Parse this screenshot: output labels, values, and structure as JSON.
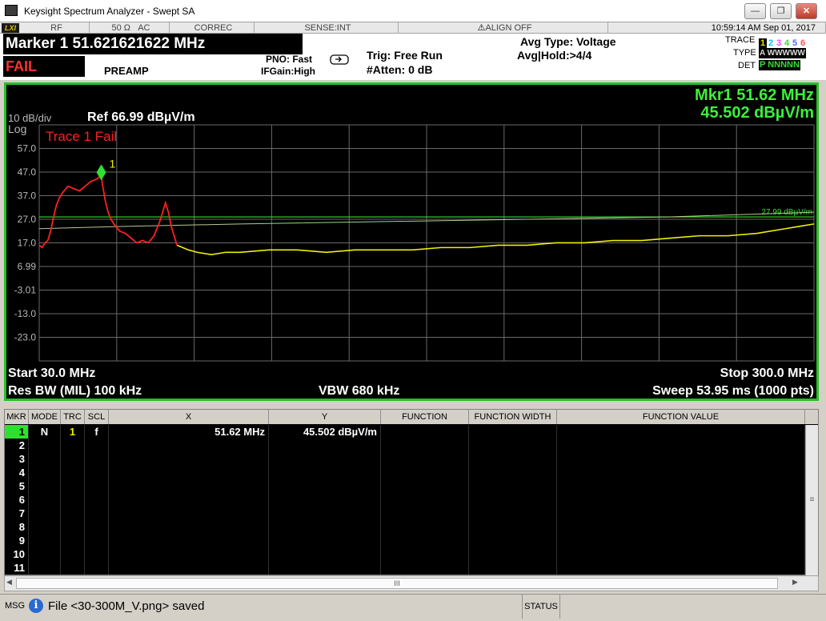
{
  "window": {
    "title": "Keysight Spectrum Analyzer - Swept SA",
    "minimize": "—",
    "restore": "❐",
    "close": "✕"
  },
  "status_strip": {
    "lxi": "LXI",
    "rf": "RF",
    "impedance": "50 Ω",
    "coupling": "AC",
    "correction": "CORREC",
    "sense": "SENSE:INT",
    "align": "ALIGN OFF",
    "datetime": "10:59:14 AM Sep 01, 2017"
  },
  "header": {
    "marker_readout": "Marker 1 51.621621622 MHz",
    "fail_flag": "FAIL",
    "preamp": "PREAMP",
    "pno": "PNO: Fast",
    "ifgain": "IFGain:High",
    "trig": "Trig: Free Run",
    "atten": "#Atten: 0 dB",
    "avg_type": "Avg Type: Voltage",
    "avg_hold": "Avg|Hold:>4/4",
    "trace_label": "TRACE",
    "type_label": "TYPE",
    "det_label": "DET",
    "trace_nums": [
      "1",
      "2",
      "3",
      "4",
      "5",
      "6"
    ],
    "trace_colors": [
      "#f0e000",
      "#00c8ff",
      "#ff40ff",
      "#30e030",
      "#6060ff",
      "#ff5050"
    ],
    "type_row": "A WWWWW",
    "det_row": "P NNNNN"
  },
  "plot": {
    "scale": "10 dB/div",
    "log": "Log",
    "ref": "Ref 66.99 dBµV/m",
    "trace_fail": "Trace 1 Fail",
    "marker_num": "1",
    "mkr_freq": "Mkr1 51.62 MHz",
    "mkr_amp": "45.502 dBµV/m",
    "limit_label": "27.99 dBµV/m",
    "start": "Start 30.0 MHz",
    "stop": "Stop 300.0 MHz",
    "rbw": "Res BW (MIL)  100 kHz",
    "vbw": "VBW 680 kHz",
    "sweep": "Sweep  53.95 ms (1000 pts)",
    "y_ticks": [
      "57.0",
      "47.0",
      "37.0",
      "27.0",
      "17.0",
      "6.99",
      "-3.01",
      "-13.0",
      "-23.0"
    ],
    "colors": {
      "trace": "#f0f000",
      "fail": "#ff2020",
      "limit": "#30e030",
      "marker": "#30e030",
      "grid": "#6a6a6a"
    }
  },
  "chart_data": {
    "type": "line",
    "xlabel": "",
    "ylabel": "",
    "xlim": [
      30,
      300
    ],
    "ylim": [
      -33.01,
      66.99
    ],
    "x_unit": "MHz",
    "y_unit": "dBµV/m",
    "grid": true,
    "series": [
      {
        "values_x": [
          30,
          31,
          32,
          33,
          34,
          35,
          36,
          37,
          38,
          40,
          42,
          44,
          46,
          48,
          50,
          51.62,
          52,
          53,
          54,
          55,
          56,
          58,
          60,
          62,
          64,
          66,
          68,
          70,
          72,
          73,
          74,
          75,
          76,
          77,
          78,
          80,
          82,
          85,
          90,
          95,
          100,
          110,
          120,
          130,
          140,
          150,
          160,
          170,
          180,
          190,
          200,
          210,
          220,
          230,
          240,
          250,
          260,
          270,
          280,
          290,
          295,
          300
        ],
        "values_y": [
          16,
          15,
          17,
          18,
          22,
          28,
          33,
          36,
          38,
          41,
          40,
          39,
          41,
          43,
          44,
          45.5,
          42,
          35,
          30,
          27,
          25,
          22,
          21,
          19,
          17,
          18,
          17,
          20,
          26,
          30,
          34,
          30,
          24,
          20,
          16,
          15,
          14,
          13,
          12,
          13,
          13,
          14,
          14,
          13,
          14,
          14,
          14,
          15,
          15,
          16,
          16,
          17,
          17,
          18,
          18,
          19,
          20,
          20,
          21,
          23,
          24,
          25
        ]
      },
      {
        "name": "27.99 dBµV/m",
        "values_x": [
          30,
          300
        ],
        "values_y": [
          27.99,
          27.99
        ]
      },
      {
        "values_x": [
          30,
          60,
          100,
          150,
          200,
          250,
          300
        ],
        "values_y": [
          23,
          24,
          25,
          26,
          27,
          28,
          30
        ]
      }
    ],
    "marker": {
      "x": 51.62,
      "y": 45.502
    }
  },
  "table": {
    "headers": [
      "MKR",
      "MODE",
      "TRC",
      "SCL",
      "X",
      "Y",
      "FUNCTION",
      "FUNCTION WIDTH",
      "FUNCTION VALUE"
    ],
    "rows": [
      {
        "mkr": "1",
        "mode": "N",
        "trc": "1",
        "scl": "f",
        "x": "51.62 MHz",
        "y": "45.502 dBµV/m"
      },
      {
        "mkr": "2"
      },
      {
        "mkr": "3"
      },
      {
        "mkr": "4"
      },
      {
        "mkr": "5"
      },
      {
        "mkr": "6"
      },
      {
        "mkr": "7"
      },
      {
        "mkr": "8"
      },
      {
        "mkr": "9"
      },
      {
        "mkr": "10"
      },
      {
        "mkr": "11"
      }
    ],
    "scroll_grip": "III",
    "vscroll_grip": "≡",
    "left_arrow": "◀",
    "right_arrow": "▶"
  },
  "message_bar": {
    "msg_label": "MSG",
    "info_icon": "i",
    "message": "File <30-300M_V.png> saved",
    "status_label": "STATUS"
  }
}
